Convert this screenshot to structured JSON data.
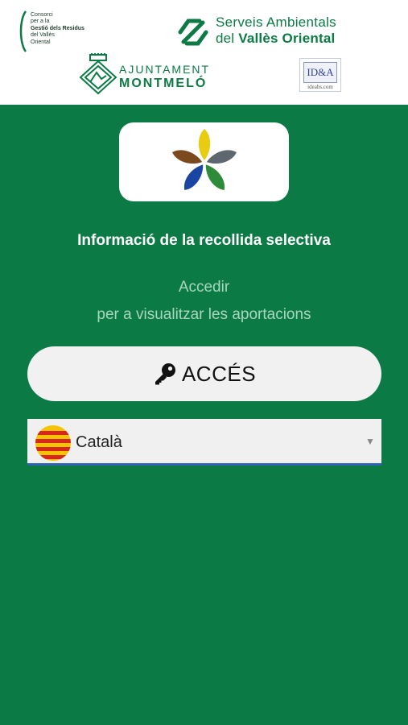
{
  "header": {
    "consorci": {
      "line1": "Consorci",
      "line2": "per a la",
      "line3": "Gestió dels Residus",
      "line4": "del Vallès",
      "line5": "Oriental"
    },
    "serveis": {
      "line1": "Serveis Ambientals",
      "line2_a": "del ",
      "line2_b": "Vallès Oriental"
    },
    "ajuntament": {
      "line1": "AJUNTAMENT",
      "line2": "MONTMELÓ"
    },
    "idea": {
      "mark": "ID&A",
      "domain": "ideabs.com"
    }
  },
  "main": {
    "title": "Informació de la recollida selectiva",
    "access_heading": "Accedir",
    "access_subtitle": "per a visualitzar les aportacions",
    "access_button_label": "ACCÉS",
    "language": {
      "selected": "Català"
    }
  },
  "colors": {
    "brand_green": "#0b7a45",
    "white": "#ffffff",
    "muted_text": "#a9d6bd",
    "select_underline": "#2d62b5"
  },
  "icons": {
    "access_button": "key-icon",
    "language": "catalan-flag-icon",
    "dropdown": "triangle-down-icon",
    "logo": "recycling-flower-logo"
  }
}
